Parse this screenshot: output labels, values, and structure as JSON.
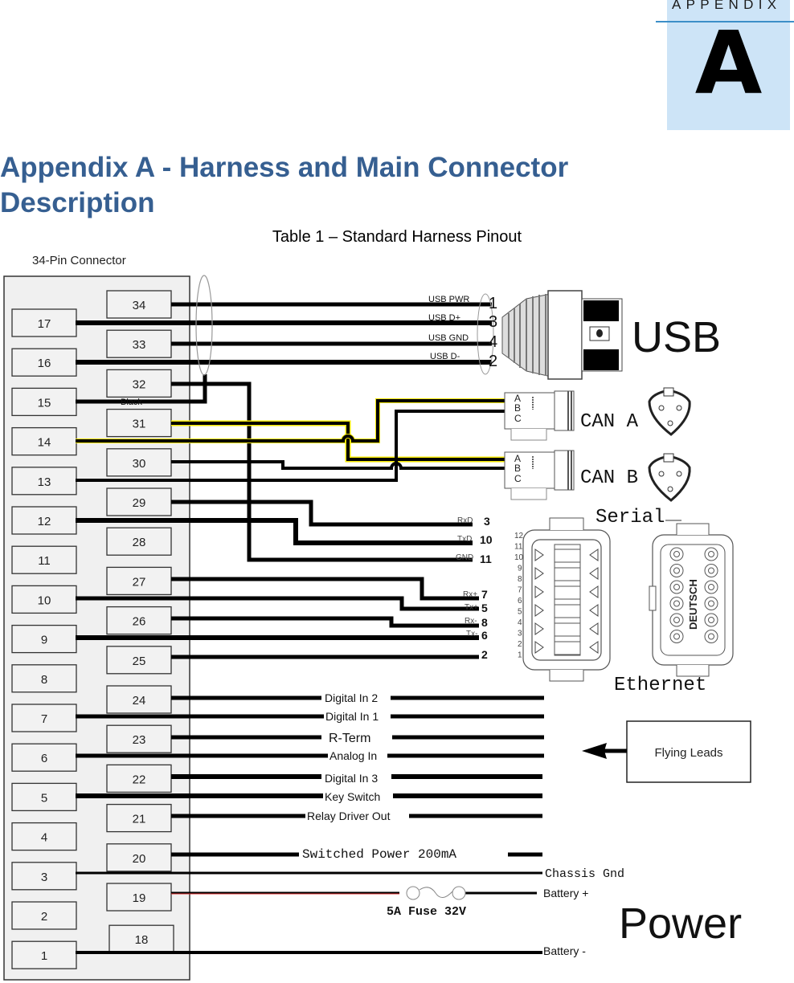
{
  "header": {
    "appendix_word": "APPENDIX",
    "appendix_letter": "A",
    "title": "Appendix A - Harness and Main Connector Description",
    "caption": "Table 1 – Standard Harness Pinout"
  },
  "colors": {
    "title_blue": "#365f91",
    "appendix_tab": "#cde4f7",
    "appendix_rule": "#3c8fc8",
    "connector_body": "#f0f0f0",
    "wire": "#000000",
    "battery_plus_trace": "#e03030",
    "can_highlight": "#f2e600"
  },
  "connector": {
    "title": "34-Pin Connector",
    "left_column_pins": [
      "17",
      "16",
      "15",
      "14",
      "13",
      "12",
      "11",
      "10",
      "9",
      "8",
      "7",
      "6",
      "5",
      "4",
      "3",
      "2",
      "1"
    ],
    "right_column_pins": [
      "34",
      "33",
      "32",
      "31",
      "30",
      "29",
      "28",
      "27",
      "26",
      "25",
      "24",
      "23",
      "22",
      "21",
      "20",
      "19",
      "18"
    ],
    "black_label": "Black"
  },
  "usb": {
    "label": "USB",
    "wires": [
      {
        "pin": "34",
        "name": "USB PWR",
        "num": "1"
      },
      {
        "pin": "17",
        "name": "USB D+",
        "num": "3"
      },
      {
        "pin": "33",
        "name": "USB GND",
        "num": "4"
      },
      {
        "pin": "16",
        "name": "USB D-",
        "num": "2"
      }
    ]
  },
  "can": {
    "can_a": "CAN A",
    "can_b": "CAN B",
    "contacts": [
      "A",
      "B",
      "C"
    ]
  },
  "serial": {
    "label": "Serial",
    "wires": [
      {
        "pin": "29",
        "name": "RxD",
        "num": "3"
      },
      {
        "pin": "12",
        "name": "TxD",
        "num": "10"
      },
      {
        "pin": "32",
        "name": "GND",
        "num": "11"
      }
    ],
    "pin_numbers": [
      "12",
      "11",
      "10",
      "9",
      "8",
      "7",
      "6",
      "5",
      "4",
      "3",
      "2",
      "1"
    ]
  },
  "ethernet": {
    "label": "Ethernet",
    "brand": "DEUTSCH",
    "wires": [
      {
        "pin": "27",
        "name": "Rx+",
        "num": "7"
      },
      {
        "pin": "10",
        "name": "Tx+",
        "num": "5"
      },
      {
        "pin": "26",
        "name": "Rx-",
        "num": "8"
      },
      {
        "pin": "9",
        "name": "Tx-",
        "num": "6"
      },
      {
        "pin": "25",
        "name": "",
        "num": "2"
      }
    ]
  },
  "flying_leads": {
    "label": "Flying Leads",
    "wires": [
      {
        "pin": "24",
        "name": "Digital In 2"
      },
      {
        "pin": "7",
        "name": "Digital In 1"
      },
      {
        "pin": "23",
        "name": "R-Term"
      },
      {
        "pin": "6",
        "name": "Analog In"
      },
      {
        "pin": "22",
        "name": "Digital In 3"
      },
      {
        "pin": "5",
        "name": "Key Switch"
      },
      {
        "pin": "21",
        "name": "Relay Driver Out"
      }
    ]
  },
  "power": {
    "label": "Power",
    "switched": "Switched Power 200mA",
    "chassis": "Chassis Gnd",
    "battery_plus": "Battery +",
    "fuse": "5A Fuse 32V",
    "battery_minus": "Battery -"
  }
}
